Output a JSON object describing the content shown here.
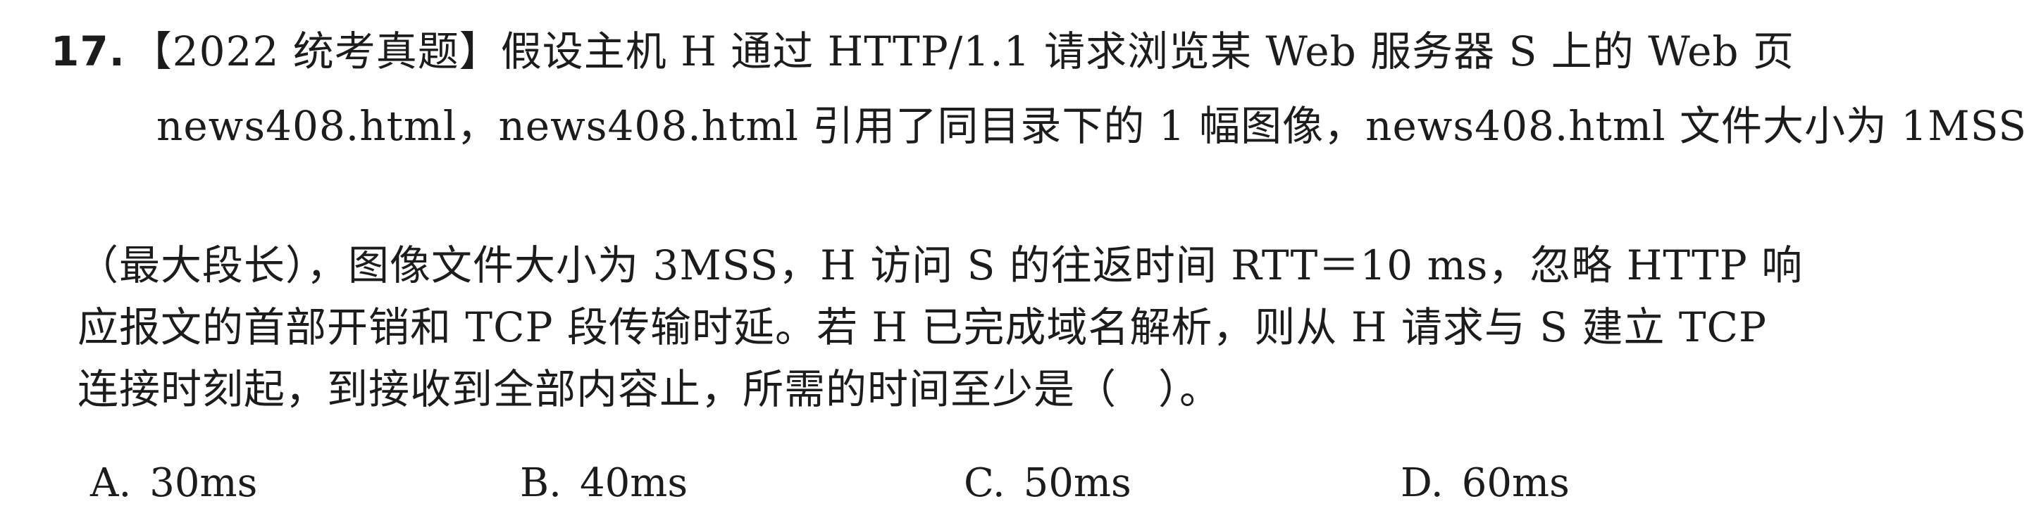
{
  "question": {
    "number": "17.",
    "line1": "【2022 统考真题】假设主机 H 通过 HTTP/1.1 请求浏览某 Web 服务器 S 上的 Web 页",
    "line2": "news408.html，news408.html 引用了同目录下的 1 幅图像，news408.html 文件大小为 1MSS",
    "line3": "（最大段长），图像文件大小为 3MSS，H 访问 S 的往返时间 RTT＝10 ms，忽略 HTTP 响",
    "line4": "应报文的首部开销和 TCP 段传输时延。若 H 已完成域名解析，则从 H 请求与 S 建立 TCP",
    "line5": "连接时刻起，到接收到全部内容止，所需的时间至少是（　）。"
  },
  "options": [
    {
      "letter": "A.",
      "text": "30ms"
    },
    {
      "letter": "B.",
      "text": "40ms"
    },
    {
      "letter": "C.",
      "text": "50ms"
    },
    {
      "letter": "D.",
      "text": "60ms"
    }
  ]
}
